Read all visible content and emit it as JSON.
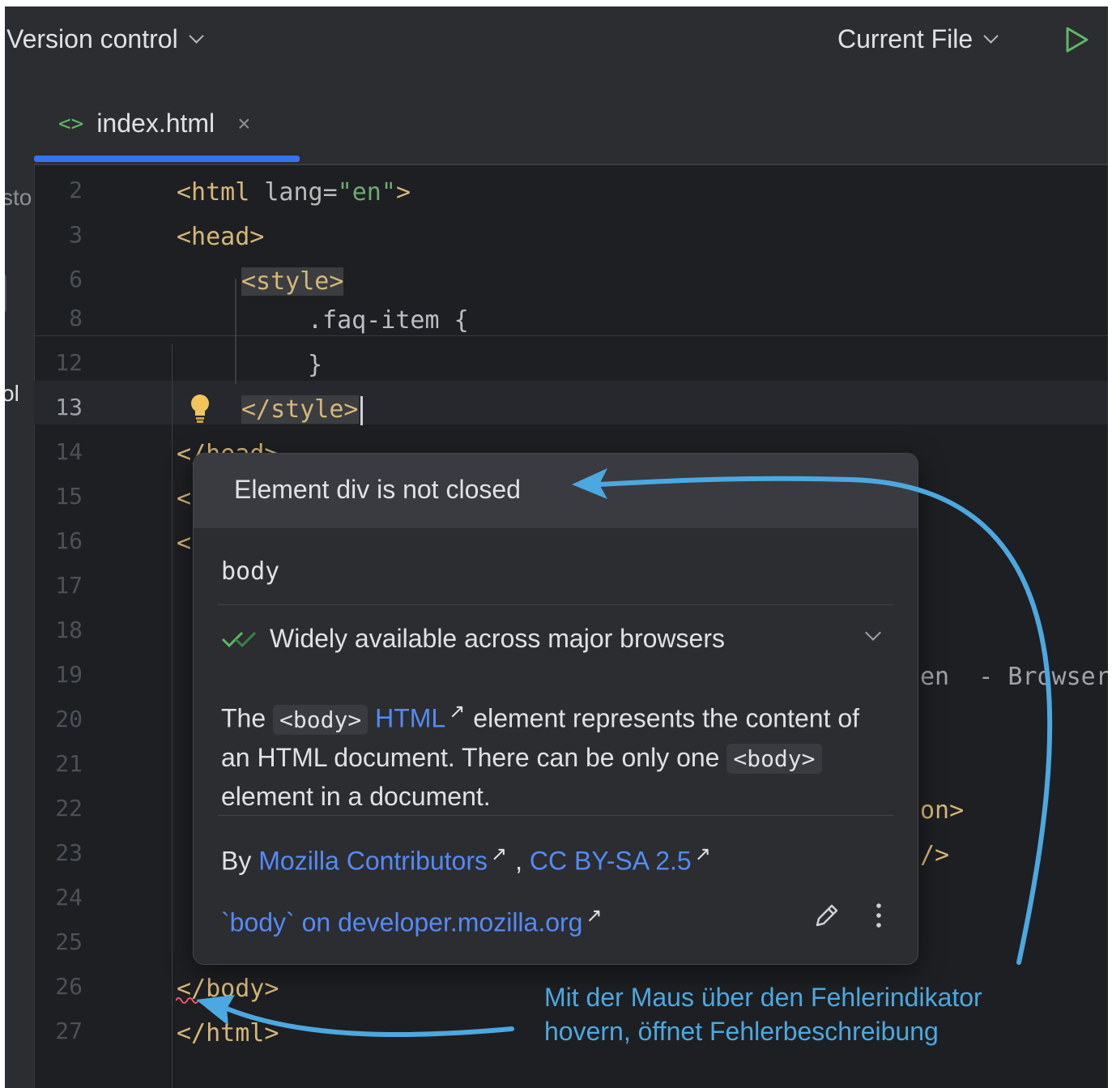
{
  "toolbar": {
    "version_control": "Version control",
    "current_file": "Current File"
  },
  "left_strip": {
    "text1": "sto",
    "text2": "ol"
  },
  "tab": {
    "icon": "<>",
    "name": "index.html",
    "close": "×"
  },
  "editor": {
    "line_numbers": [
      "2",
      "3",
      "6",
      "8",
      "12",
      "13",
      "14",
      "15",
      "16",
      "17",
      "18",
      "19",
      "20",
      "21",
      "22",
      "23",
      "24",
      "25",
      "26",
      "27"
    ],
    "current_line": "13",
    "lines": {
      "l2_tag_open": "<html ",
      "l2_attr": "lang",
      "l2_eq": "=",
      "l2_str": "\"en\"",
      "l2_close": ">",
      "l3": "<head>",
      "l6": "<style>",
      "l8": ".faq-item {",
      "l12": "}",
      "l13": "</style>",
      "l14": "</head>",
      "l15": "<",
      "l16": "<",
      "l19_tail": "en  - Browser",
      "l22_tail": "on>",
      "l23_tail": "/>",
      "l26": "</body>",
      "l27": "</html>"
    }
  },
  "popup": {
    "title": "Element div is not closed",
    "element_name": "body",
    "availability": "Widely available across major browsers",
    "desc_the": "The ",
    "desc_body_tag": "<body>",
    "desc_html_link": "HTML",
    "desc_part1": "element represents the content of an HTML document. There can be only one ",
    "desc_body_tag2": "<body>",
    "desc_part2": " element in a document.",
    "by_label": "By ",
    "by_link1": "Mozilla Contributors",
    "by_comma": ", ",
    "by_link2": "CC BY-SA 2.5",
    "mdn_link": "`body` on developer.mozilla.org",
    "ext_arrow": "↗"
  },
  "annotation": {
    "line1": "Mit der Maus über den Fehlerindikator",
    "line2": "hovern, öffnet Fehlerbeschreibung",
    "color": "#4ca8e0"
  },
  "colors": {
    "accent": "#3574f0",
    "link": "#548af7",
    "run": "#5fb865"
  }
}
